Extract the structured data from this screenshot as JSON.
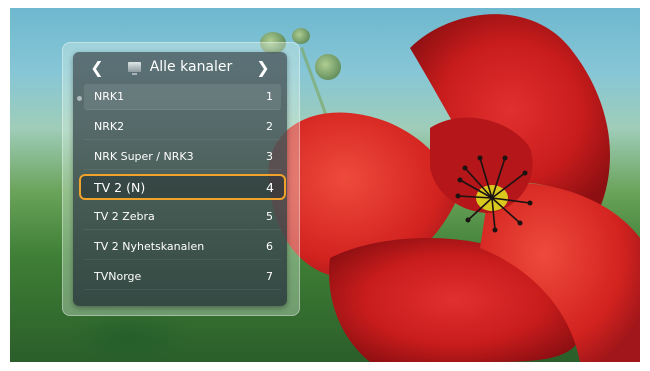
{
  "header": {
    "title": "Alle kanaler",
    "prev_icon": "chevron-left-icon",
    "next_icon": "chevron-right-icon",
    "category_icon": "tv-icon"
  },
  "channels": [
    {
      "name": "NRK1",
      "number": "1"
    },
    {
      "name": "NRK2",
      "number": "2"
    },
    {
      "name": "NRK Super / NRK3",
      "number": "3"
    },
    {
      "name": "TV 2 (N)",
      "number": "4",
      "selected": true
    },
    {
      "name": "TV 2 Zebra",
      "number": "5"
    },
    {
      "name": "TV 2 Nyhetskanalen",
      "number": "6"
    },
    {
      "name": "TVNorge",
      "number": "7"
    }
  ],
  "colors": {
    "highlight": "#f0a22a",
    "panel": "#3c4b4f",
    "text": "#ffffff"
  }
}
